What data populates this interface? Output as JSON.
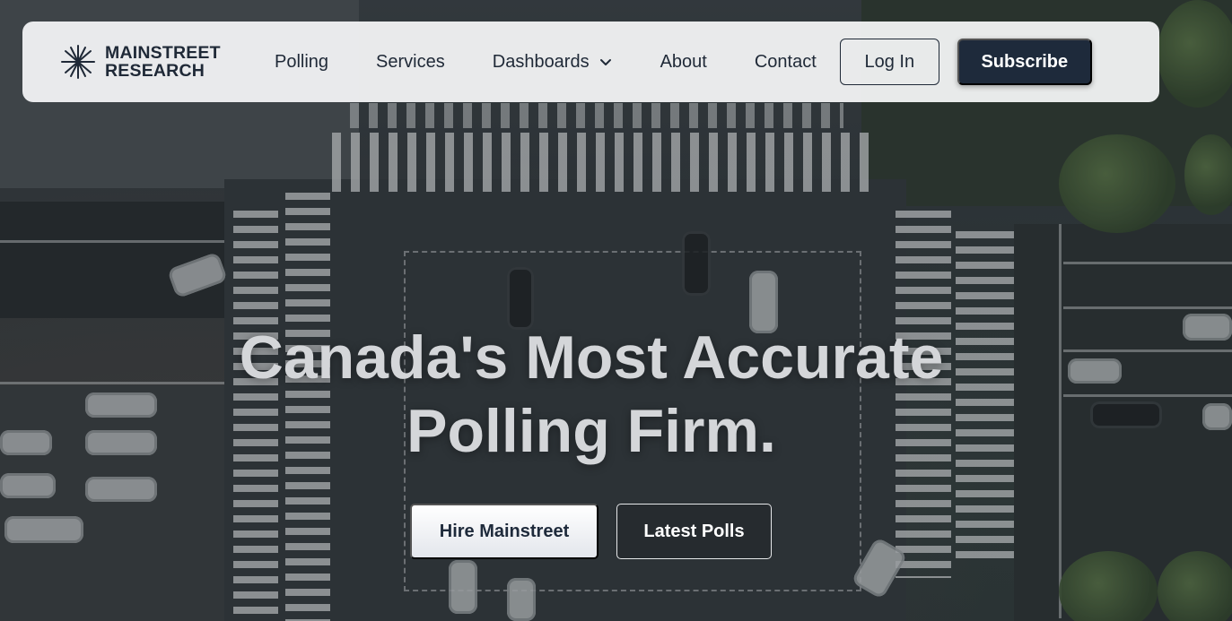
{
  "brand": {
    "line1": "MAINSTREET",
    "line2": "RESEARCH",
    "icon": "mainstreet-logo-mark"
  },
  "nav": {
    "links": [
      {
        "label": "Polling"
      },
      {
        "label": "Services"
      },
      {
        "label": "Dashboards",
        "icon": "chevron-down-icon"
      },
      {
        "label": "About"
      },
      {
        "label": "Contact"
      }
    ],
    "login_label": "Log In",
    "subscribe_label": "Subscribe"
  },
  "hero": {
    "title_line1": "Canada's Most Accurate",
    "title_line2": "Polling Firm.",
    "primary_cta": "Hire Mainstreet",
    "secondary_cta": "Latest Polls"
  },
  "colors": {
    "navy": "#1e2a3b",
    "nav_bg": "#f0f1f2",
    "title_text": "#d4d6d9"
  }
}
